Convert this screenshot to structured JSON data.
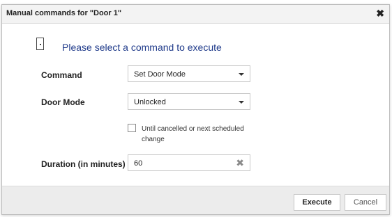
{
  "dialog": {
    "title": "Manual commands for \"Door 1\"",
    "close_icon": "close-icon",
    "prompt": "Please select a command to execute",
    "door_icon": "door-icon"
  },
  "form": {
    "command_label": "Command",
    "command_value": "Set Door Mode",
    "door_mode_label": "Door Mode",
    "door_mode_value": "Unlocked",
    "until_cancelled_label": "Until cancelled or next scheduled change",
    "until_cancelled_checked": false,
    "duration_label": "Duration (in minutes)",
    "duration_value": "60"
  },
  "footer": {
    "execute_label": "Execute",
    "cancel_label": "Cancel"
  },
  "colors": {
    "prompt_text": "#1f3a8a",
    "footer_bg": "#ececec",
    "title_bg": "#f3f3f3"
  }
}
